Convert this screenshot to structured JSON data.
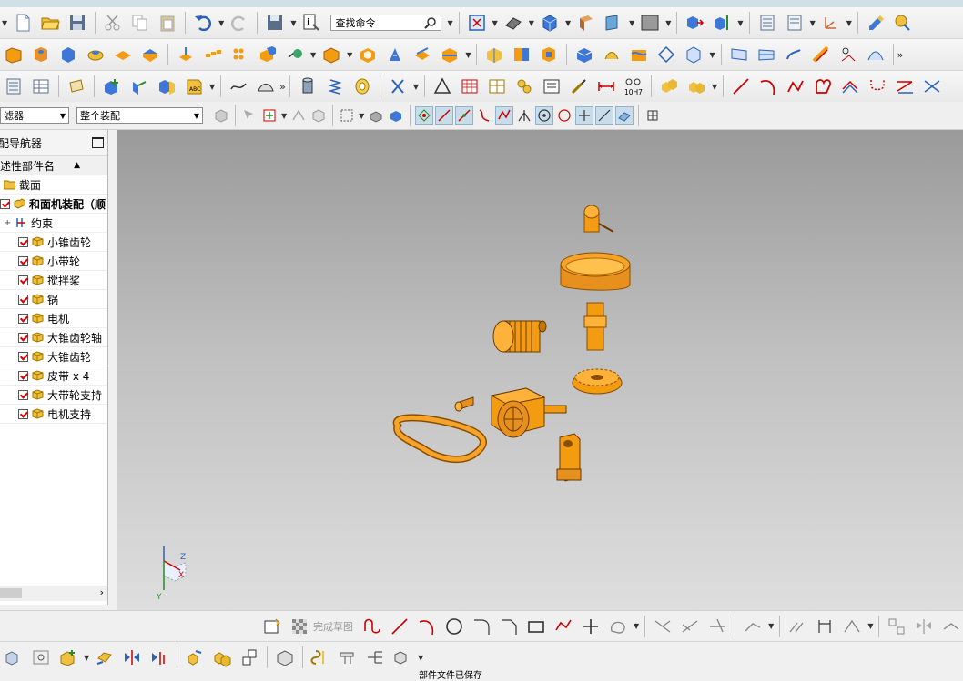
{
  "toolbar": {
    "command_search_placeholder": "查找命令",
    "label_10h7": "10H7"
  },
  "selection_bar": {
    "filter_label": "滤器",
    "assembly_scope": "整个装配"
  },
  "navigator": {
    "title": "配导航器",
    "column_header": "述性部件名",
    "section_label": "截面",
    "root_label": "和面机装配（顺",
    "constraints_label": "约束",
    "parts": [
      {
        "label": "小锥齿轮"
      },
      {
        "label": "小带轮"
      },
      {
        "label": "搅拌桨"
      },
      {
        "label": "锅"
      },
      {
        "label": "电机"
      },
      {
        "label": "大锥齿轮轴"
      },
      {
        "label": "大锥齿轮"
      },
      {
        "label": "皮带 x 4"
      },
      {
        "label": "大带轮支持"
      },
      {
        "label": "电机支持"
      }
    ]
  },
  "viewport": {
    "triad_labels": {
      "z": "Z",
      "x": "X",
      "y": "Y"
    }
  },
  "sketch_bar": {
    "finish_sketch_label": "完成草图"
  },
  "status_bar": {
    "message": "部件文件已保存"
  },
  "colors": {
    "part_orange": "#f39c12",
    "part_dark": "#b5690a",
    "viewport_top": "#9a9a9a",
    "viewport_bottom": "#dedede",
    "checkbox_red": "#dd0000"
  }
}
